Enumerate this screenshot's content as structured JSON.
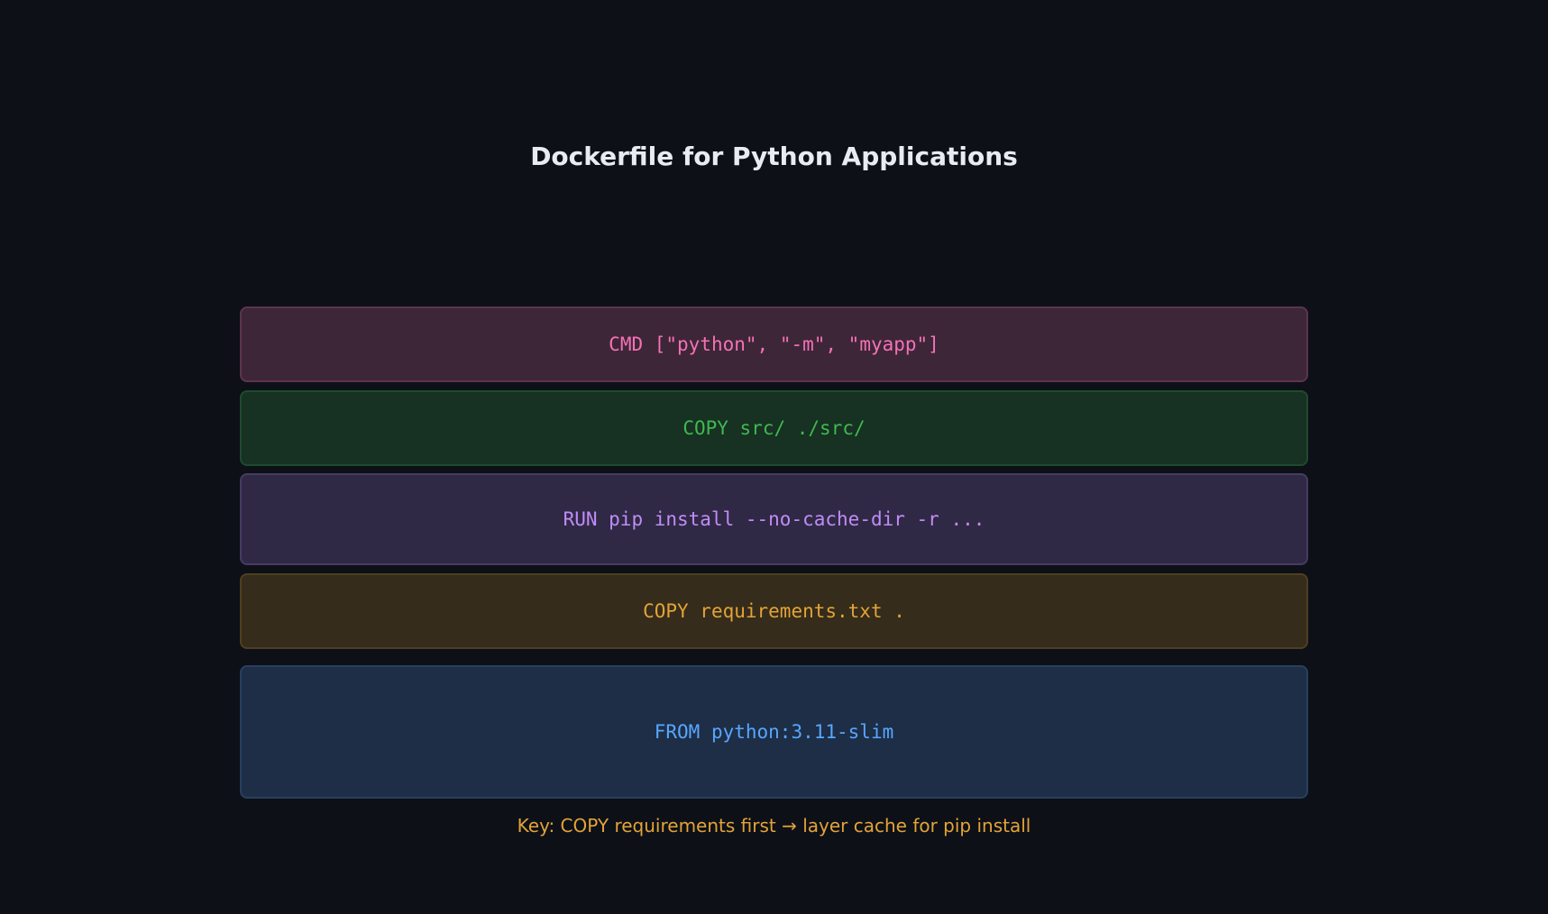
{
  "title": "Dockerfile for Python Applications",
  "layers": [
    {
      "text": "CMD [\"python\", \"-m\", \"myapp\"]",
      "text_color": "#f472b6",
      "fill": "#3d2638",
      "border": "#5b3450"
    },
    {
      "text": "COPY src/ ./src/",
      "text_color": "#3fb950",
      "fill": "#173123",
      "border": "#1f4a2e"
    },
    {
      "text": "RUN pip install --no-cache-dir -r ...",
      "text_color": "#c08cf7",
      "fill": "#302945",
      "border": "#463b62"
    },
    {
      "text": "COPY requirements.txt .",
      "text_color": "#e3a338",
      "fill": "#352c1b",
      "border": "#4e3f1f"
    },
    {
      "text": "FROM python:3.11-slim",
      "text_color": "#58a6ff",
      "fill": "#1d2e46",
      "border": "#283f5f"
    }
  ],
  "key": {
    "text": "Key: COPY requirements first → layer cache for pip install",
    "color": "#e3a338"
  }
}
